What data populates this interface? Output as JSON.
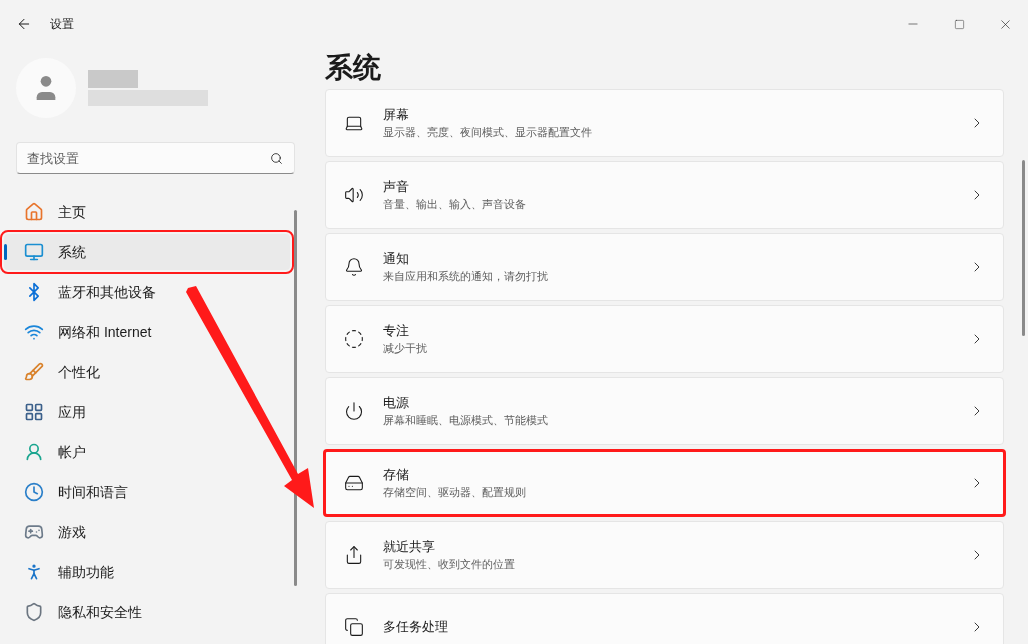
{
  "window": {
    "title": "设置"
  },
  "search": {
    "placeholder": "查找设置"
  },
  "nav": [
    {
      "label": "主页",
      "selected": false,
      "highlighted": false
    },
    {
      "label": "系统",
      "selected": true,
      "highlighted": true
    },
    {
      "label": "蓝牙和其他设备",
      "selected": false,
      "highlighted": false
    },
    {
      "label": "网络和 Internet",
      "selected": false,
      "highlighted": false
    },
    {
      "label": "个性化",
      "selected": false,
      "highlighted": false
    },
    {
      "label": "应用",
      "selected": false,
      "highlighted": false
    },
    {
      "label": "帐户",
      "selected": false,
      "highlighted": false
    },
    {
      "label": "时间和语言",
      "selected": false,
      "highlighted": false
    },
    {
      "label": "游戏",
      "selected": false,
      "highlighted": false
    },
    {
      "label": "辅助功能",
      "selected": false,
      "highlighted": false
    },
    {
      "label": "隐私和安全性",
      "selected": false,
      "highlighted": false
    }
  ],
  "page_title": "系统",
  "cards": [
    {
      "title": "屏幕",
      "subtitle": "显示器、亮度、夜间模式、显示器配置文件",
      "highlighted": false
    },
    {
      "title": "声音",
      "subtitle": "音量、输出、输入、声音设备",
      "highlighted": false
    },
    {
      "title": "通知",
      "subtitle": "来自应用和系统的通知，请勿打扰",
      "highlighted": false
    },
    {
      "title": "专注",
      "subtitle": "减少干扰",
      "highlighted": false
    },
    {
      "title": "电源",
      "subtitle": "屏幕和睡眠、电源模式、节能模式",
      "highlighted": false
    },
    {
      "title": "存储",
      "subtitle": "存储空间、驱动器、配置规则",
      "highlighted": true
    },
    {
      "title": "就近共享",
      "subtitle": "可发现性、收到文件的位置",
      "highlighted": false
    },
    {
      "title": "多任务处理",
      "highlighted": false
    }
  ]
}
